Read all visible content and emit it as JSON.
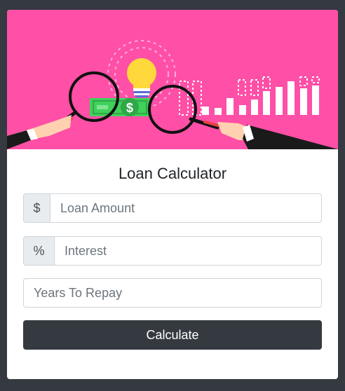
{
  "title": "Loan Calculator",
  "form": {
    "amount": {
      "addon": "$",
      "placeholder": "Loan Amount"
    },
    "interest": {
      "addon": "%",
      "placeholder": "Interest"
    },
    "years": {
      "placeholder": "Years To Repay"
    },
    "submit_label": "Calculate"
  },
  "colors": {
    "page_bg": "#343a40",
    "hero_bg": "#ff4fa7",
    "button_bg": "#343a40",
    "bill_green": "#3fd15a",
    "bulb_yellow": "#ffd93b"
  },
  "icons": [
    "lightbulb-icon",
    "magnifying-glass-icon",
    "money-bill-icon",
    "bar-chart-icon"
  ]
}
